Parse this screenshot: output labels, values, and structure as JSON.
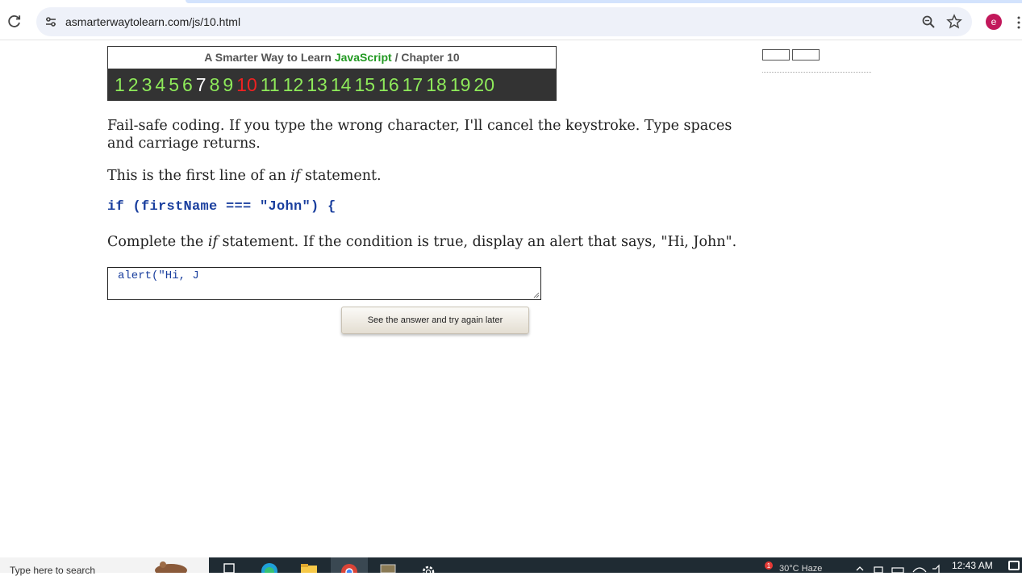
{
  "browser": {
    "url": "asmarterwaytolearn.com/js/10.html",
    "profile_initial": "e"
  },
  "header": {
    "title_prefix": "A Smarter Way to Learn",
    "title_brand": "JavaScript",
    "separator": "/",
    "chapter_label": "Chapter 10",
    "chapters": [
      "1",
      "2",
      "3",
      "4",
      "5",
      "6",
      "7",
      "8",
      "9",
      "10",
      "11",
      "12",
      "13",
      "14",
      "15",
      "16",
      "17",
      "18",
      "19",
      "20"
    ],
    "visited_chapter": "7",
    "current_chapter": "10"
  },
  "lesson": {
    "instructions": "Fail-safe coding. If you type the wrong character, I'll cancel the keystroke. Type spaces and carriage returns.",
    "intro_before": "This is the first line of an ",
    "intro_keyword": "if",
    "intro_after": " statement.",
    "code_line": "if (firstName === \"John\") {",
    "task_before": "Complete the ",
    "task_keyword": "if",
    "task_after": " statement. If the condition is true, display an alert that says, \"Hi, John\".",
    "answer_value": "alert(\"Hi, J",
    "answer_button": "See the answer and try again later"
  },
  "taskbar": {
    "search_text": "Type here to search",
    "weather": "30°C  Haze",
    "clock": "12:43 AM",
    "widget_badge": "1"
  },
  "colors": {
    "chapter_link": "#8eea5a",
    "chapter_current": "#ee2222",
    "chapter_visited": "#ffffff",
    "brand_green": "#229922",
    "code_blue": "#1a3f9e"
  }
}
